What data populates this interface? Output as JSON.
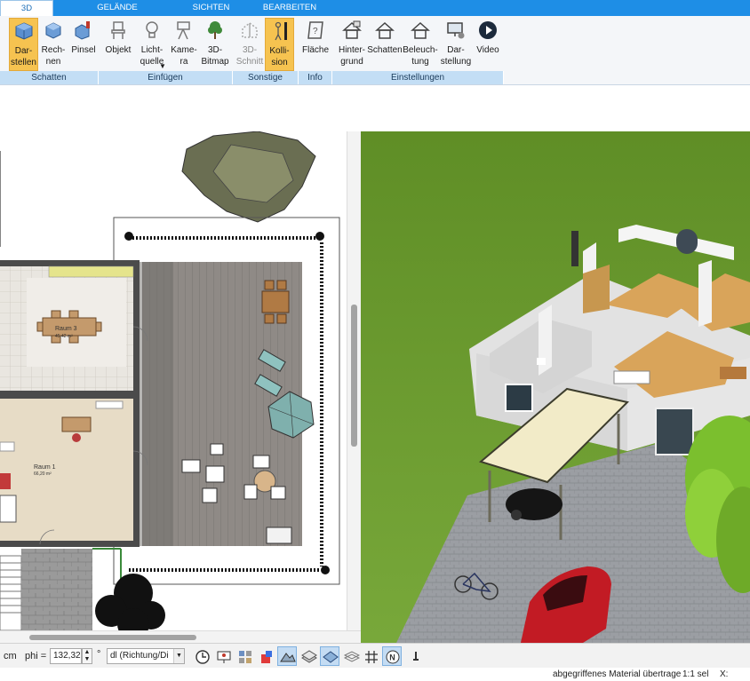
{
  "ribbon": {
    "tabs": [
      {
        "label": "3D",
        "active": true
      },
      {
        "label": "GELÄNDE",
        "active": false
      },
      {
        "label": "SICHTEN",
        "active": false
      },
      {
        "label": "BEARBEITEN",
        "active": false
      }
    ],
    "buttons": {
      "darstellen": "Dar-\nstellen",
      "rechnen": "Rech-\nnen",
      "pinsel": "Pinsel",
      "objekt": "Objekt",
      "lichtquelle": "Licht-\nquelle",
      "kamera": "Kame-\nra",
      "bitmap": "3D-\nBitmap",
      "schnitt": "3D-\nSchnitt",
      "kollision": "Kolli-\nsion",
      "flaeche": "Fläche",
      "hintergrund": "Hinter-\ngrund",
      "schatten2": "Schatten",
      "beleuchtung": "Beleuch-\ntung",
      "darstellung": "Dar-\nstellung",
      "video": "Video"
    },
    "groups": {
      "schatten": "Schatten",
      "einfuegen": "Einfügen",
      "sonstige": "Sonstige",
      "info": "Info",
      "einstellungen": "Einstellungen"
    }
  },
  "plan": {
    "room3_name": "Raum 3",
    "room3_area": "45,42 m²",
    "room1_name": "Raum 1",
    "room1_area": "66,20 m²"
  },
  "bottombar": {
    "unit": "cm",
    "phi_label": "phi =",
    "phi_value": "132,32",
    "degree": "°",
    "dl_select": "dl (Richtung/Di"
  },
  "status": {
    "message": "abgegriffenes Material übertrage",
    "scale": "1:1 sel",
    "x_label": "X:"
  },
  "colors": {
    "ribbon_blue": "#1e8ee6",
    "group_bar": "#c3def5",
    "active_button": "#f6c350",
    "grass": "#6a9a2a"
  }
}
